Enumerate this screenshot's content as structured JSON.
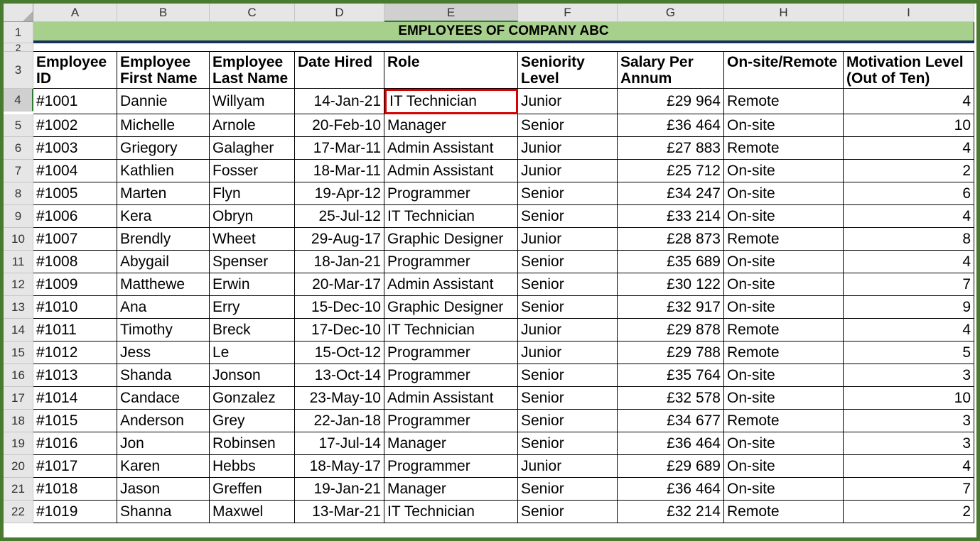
{
  "title": "EMPLOYEES OF COMPANY ABC",
  "columns": [
    "A",
    "B",
    "C",
    "D",
    "E",
    "F",
    "G",
    "H",
    "I"
  ],
  "selected_col": "E",
  "selected_row": 4,
  "headers": {
    "A": "Employee ID",
    "B": "Employee First Name",
    "C": "Employee Last Name",
    "D": "Date Hired",
    "E": "Role",
    "F": "Seniority Level",
    "G": "Salary Per Annum",
    "H": "On-site/Remote",
    "I": "Motivation Level (Out of Ten)"
  },
  "rows": [
    {
      "n": 4,
      "A": "#1001",
      "B": "Dannie",
      "C": "Willyam",
      "D": "14-Jan-21",
      "E": "IT Technician",
      "F": "Junior",
      "G": "£29 964",
      "H": "Remote",
      "I": "4",
      "hl": true
    },
    {
      "n": 5,
      "A": "#1002",
      "B": "Michelle",
      "C": "Arnole",
      "D": "20-Feb-10",
      "E": "Manager",
      "F": "Senior",
      "G": "£36 464",
      "H": "On-site",
      "I": "10"
    },
    {
      "n": 6,
      "A": "#1003",
      "B": "Griegory",
      "C": "Galagher",
      "D": "17-Mar-11",
      "E": "Admin Assistant",
      "F": "Junior",
      "G": "£27 883",
      "H": "Remote",
      "I": "4"
    },
    {
      "n": 7,
      "A": "#1004",
      "B": "Kathlien",
      "C": "Fosser",
      "D": "18-Mar-11",
      "E": "Admin Assistant",
      "F": "Junior",
      "G": "£25 712",
      "H": "On-site",
      "I": "2"
    },
    {
      "n": 8,
      "A": "#1005",
      "B": "Marten",
      "C": "Flyn",
      "D": "19-Apr-12",
      "E": "Programmer",
      "F": "Senior",
      "G": "£34 247",
      "H": "On-site",
      "I": "6"
    },
    {
      "n": 9,
      "A": "#1006",
      "B": "Kera",
      "C": "Obryn",
      "D": "25-Jul-12",
      "E": "IT Technician",
      "F": "Senior",
      "G": "£33 214",
      "H": "On-site",
      "I": "4"
    },
    {
      "n": 10,
      "A": "#1007",
      "B": "Brendly",
      "C": "Wheet",
      "D": "29-Aug-17",
      "E": "Graphic Designer",
      "F": "Junior",
      "G": "£28 873",
      "H": "Remote",
      "I": "8"
    },
    {
      "n": 11,
      "A": "#1008",
      "B": "Abygail",
      "C": "Spenser",
      "D": "18-Jan-21",
      "E": "Programmer",
      "F": "Senior",
      "G": "£35 689",
      "H": "On-site",
      "I": "4"
    },
    {
      "n": 12,
      "A": "#1009",
      "B": "Matthewe",
      "C": "Erwin",
      "D": "20-Mar-17",
      "E": "Admin Assistant",
      "F": "Senior",
      "G": "£30 122",
      "H": "On-site",
      "I": "7"
    },
    {
      "n": 13,
      "A": "#1010",
      "B": "Ana",
      "C": "Erry",
      "D": "15-Dec-10",
      "E": "Graphic Designer",
      "F": "Senior",
      "G": "£32 917",
      "H": "On-site",
      "I": "9"
    },
    {
      "n": 14,
      "A": "#1011",
      "B": "Timothy",
      "C": "Breck",
      "D": "17-Dec-10",
      "E": "IT Technician",
      "F": "Junior",
      "G": "£29 878",
      "H": "Remote",
      "I": "4"
    },
    {
      "n": 15,
      "A": "#1012",
      "B": "Jess",
      "C": "Le",
      "D": "15-Oct-12",
      "E": "Programmer",
      "F": "Junior",
      "G": "£29 788",
      "H": "Remote",
      "I": "5"
    },
    {
      "n": 16,
      "A": "#1013",
      "B": "Shanda",
      "C": "Jonson",
      "D": "13-Oct-14",
      "E": "Programmer",
      "F": "Senior",
      "G": "£35 764",
      "H": "On-site",
      "I": "3"
    },
    {
      "n": 17,
      "A": "#1014",
      "B": "Candace",
      "C": "Gonzalez",
      "D": "23-May-10",
      "E": "Admin Assistant",
      "F": "Senior",
      "G": "£32 578",
      "H": "On-site",
      "I": "10"
    },
    {
      "n": 18,
      "A": "#1015",
      "B": "Anderson",
      "C": "Grey",
      "D": "22-Jan-18",
      "E": "Programmer",
      "F": "Senior",
      "G": "£34 677",
      "H": "Remote",
      "I": "3"
    },
    {
      "n": 19,
      "A": "#1016",
      "B": "Jon",
      "C": "Robinsen",
      "D": "17-Jul-14",
      "E": "Manager",
      "F": "Senior",
      "G": "£36 464",
      "H": "On-site",
      "I": "3"
    },
    {
      "n": 20,
      "A": "#1017",
      "B": "Karen",
      "C": "Hebbs",
      "D": "18-May-17",
      "E": "Programmer",
      "F": "Junior",
      "G": "£29 689",
      "H": "On-site",
      "I": "4"
    },
    {
      "n": 21,
      "A": "#1018",
      "B": "Jason",
      "C": "Greffen",
      "D": "19-Jan-21",
      "E": "Manager",
      "F": "Senior",
      "G": "£36 464",
      "H": "On-site",
      "I": "7"
    },
    {
      "n": 22,
      "A": "#1019",
      "B": "Shanna",
      "C": "Maxwel",
      "D": "13-Mar-21",
      "E": "IT Technician",
      "F": "Senior",
      "G": "£32 214",
      "H": "Remote",
      "I": "2"
    }
  ]
}
